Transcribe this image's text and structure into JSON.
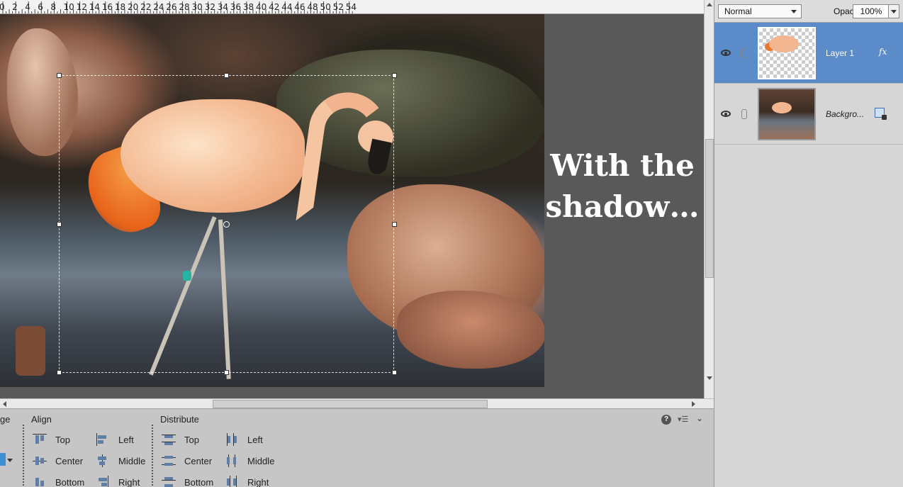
{
  "ruler": {
    "labels": [
      "0",
      "2",
      "4",
      "6",
      "8",
      "10",
      "12",
      "14",
      "16",
      "18",
      "20",
      "22",
      "24",
      "26",
      "28",
      "30",
      "32",
      "34",
      "36",
      "38",
      "40",
      "42",
      "44",
      "46",
      "48",
      "50",
      "52",
      "54"
    ]
  },
  "canvas": {
    "caption_line1": "With the",
    "caption_line2": "shadow…"
  },
  "options": {
    "arrange_partial": "ge",
    "align_title": "Align",
    "align_items": [
      "Top",
      "Center",
      "Bottom",
      "Left",
      "Middle",
      "Right"
    ],
    "distribute_title": "Distribute",
    "distribute_items": [
      "Top",
      "Center",
      "Bottom",
      "Left",
      "Middle",
      "Right"
    ],
    "help_glyph": "?",
    "menu_glyph": "▾☰",
    "collapse_glyph": "⌄"
  },
  "layers_panel": {
    "blend_mode": "Normal",
    "opacity_label": "Opacity:",
    "opacity_value": "100%",
    "layers": [
      {
        "name": "Layer 1",
        "selected": true,
        "badge": "fx"
      },
      {
        "name": "Backgro...",
        "selected": false,
        "badge": "lock"
      }
    ],
    "fx_label": "fx"
  },
  "colors": {
    "selection_blue": "#5b8bc9",
    "panel_gray": "#c6c6c6",
    "canvas_gray": "#595959"
  },
  "icons": [
    "eye-icon",
    "link-icon",
    "fx-icon",
    "lock-icon",
    "help-icon",
    "panel-menu-icon",
    "collapse-icon",
    "align-top-icon",
    "align-center-icon",
    "align-bottom-icon",
    "align-left-icon",
    "align-middle-icon",
    "align-right-icon"
  ]
}
